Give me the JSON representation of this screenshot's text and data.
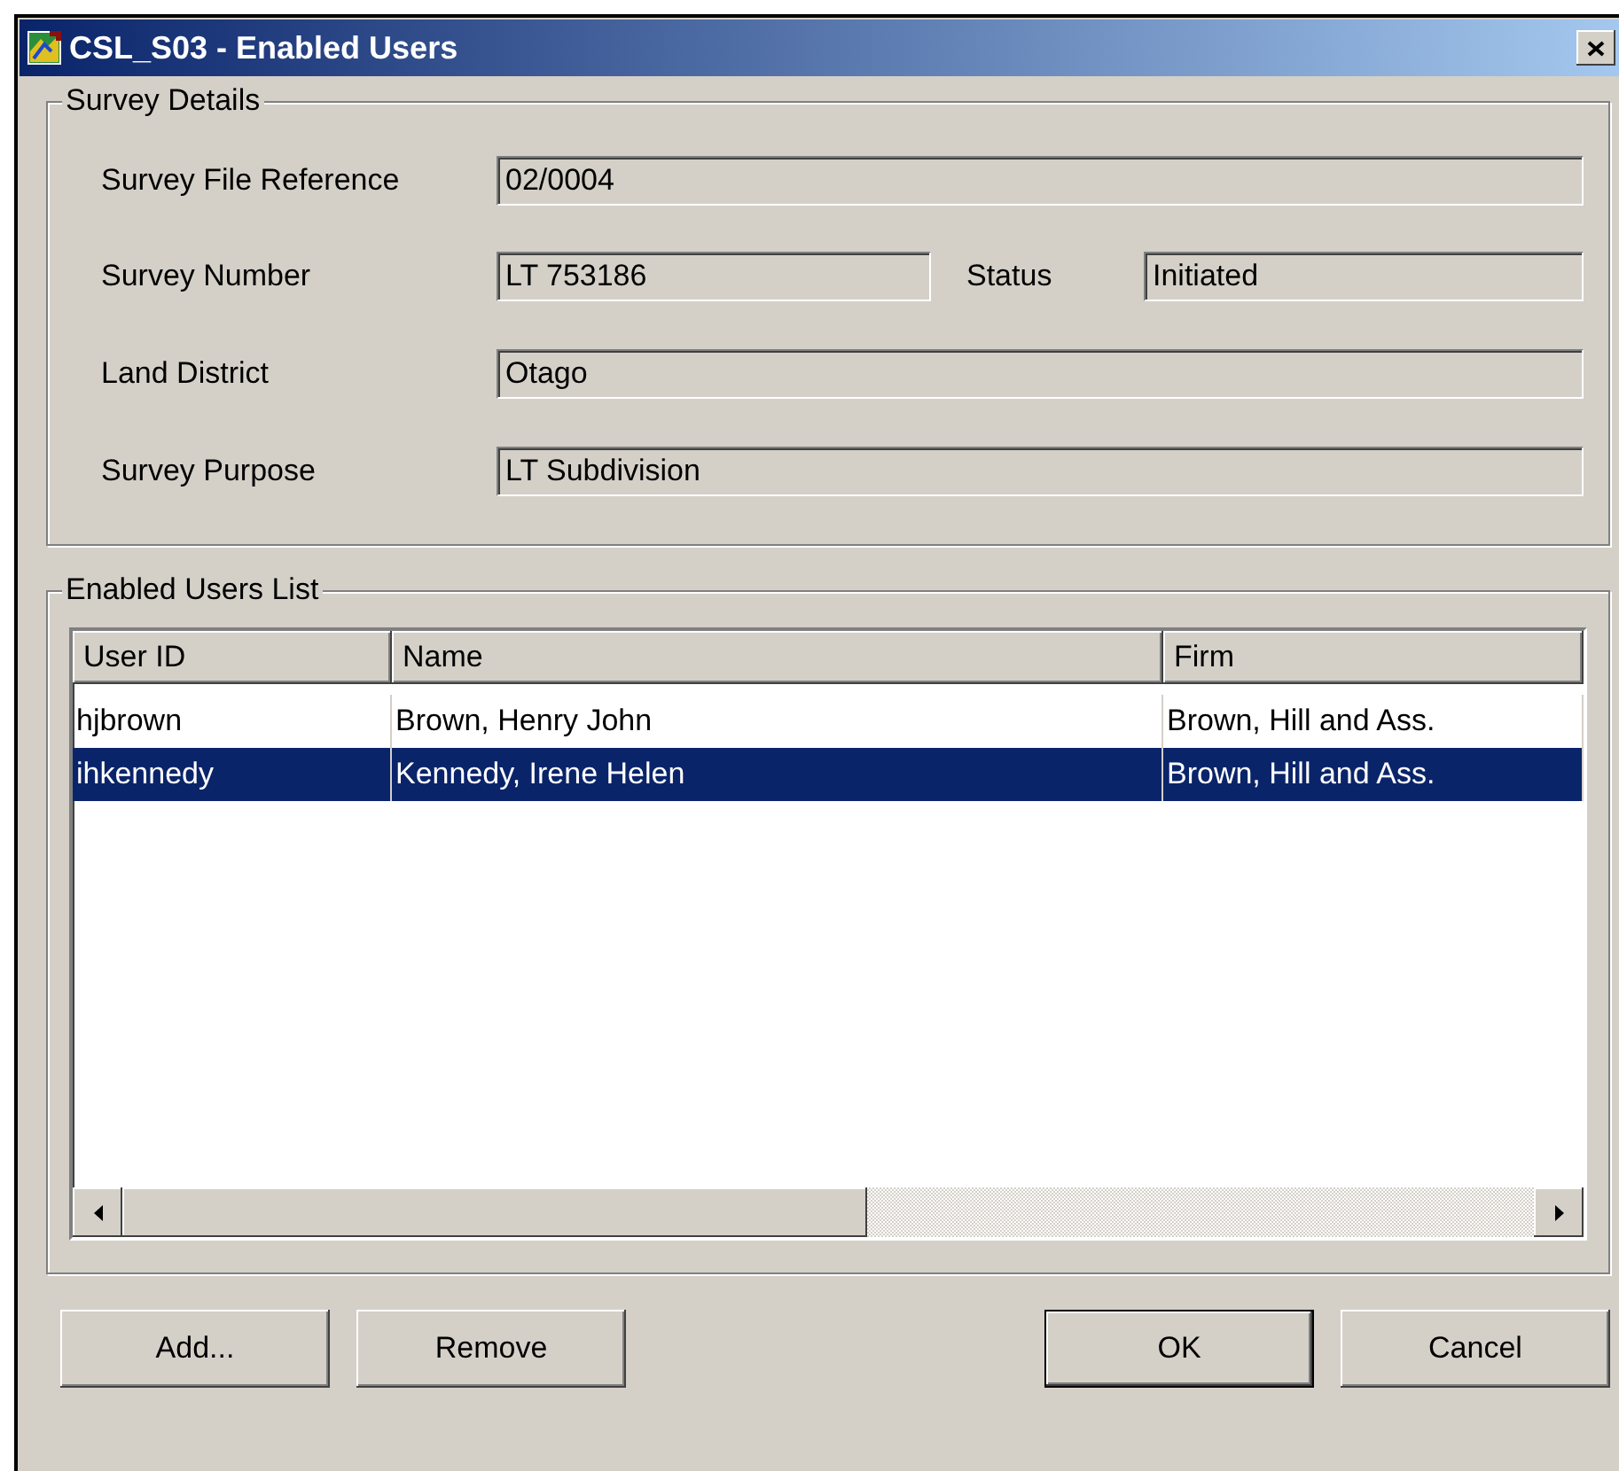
{
  "window": {
    "title": "CSL_S03 - Enabled Users"
  },
  "survey_details": {
    "title": "Survey Details",
    "rows": [
      {
        "fields": [
          {
            "label": "Survey File Reference",
            "value": "02/0004"
          }
        ]
      },
      {
        "fields": [
          {
            "label": "Survey Number",
            "value": "LT 753186"
          },
          {
            "label": "Status",
            "value": "Initiated"
          }
        ]
      },
      {
        "fields": [
          {
            "label": "Land District",
            "value": "Otago"
          }
        ]
      },
      {
        "fields": [
          {
            "label": "Survey Purpose",
            "value": "LT Subdivision"
          }
        ]
      }
    ]
  },
  "enabled_users": {
    "title": "Enabled Users List",
    "columns": [
      "User ID",
      "Name",
      "Firm"
    ],
    "rows": [
      {
        "cells": [
          "hjbrown",
          "Brown, Henry John",
          "Brown, Hill and Ass."
        ],
        "selected": false
      },
      {
        "cells": [
          "ihkennedy",
          "Kennedy, Irene Helen",
          "Brown, Hill and Ass."
        ],
        "selected": true
      }
    ]
  },
  "buttons": [
    {
      "label": "Add...",
      "default": false
    },
    {
      "label": "Remove",
      "default": false
    },
    {
      "label": "OK",
      "default": true
    },
    {
      "label": "Cancel",
      "default": false
    }
  ]
}
